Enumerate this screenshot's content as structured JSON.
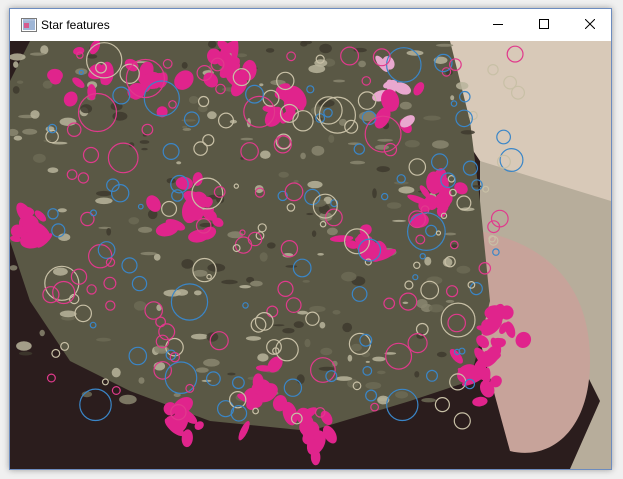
{
  "window": {
    "title": "Star features",
    "icon": "app-window-icon",
    "controls": [
      {
        "name": "minimize-button",
        "icon": "minimize-icon"
      },
      {
        "name": "maximize-button",
        "icon": "maximize-icon"
      },
      {
        "name": "close-button",
        "icon": "close-icon"
      }
    ]
  },
  "image": {
    "description_colors": {
      "dark_soil": "#2b1d1d",
      "flower_magenta": "#e0248c",
      "flower_pink_light": "#e9a8cf",
      "foliage": "#6c6a55",
      "foliage_light": "#b9b49b",
      "stone_wall": "#d8c9b8",
      "pot": "#c7a39a",
      "gravel": "#b7ad9b"
    },
    "feature_colors": [
      "#e03a8c",
      "#3a86c8",
      "#c8c0a6"
    ]
  }
}
